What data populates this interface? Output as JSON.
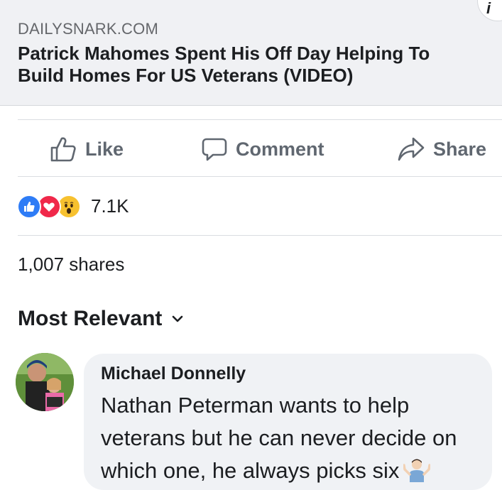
{
  "link_preview": {
    "source": "DAILYSNARK.COM",
    "title": "Patrick Mahomes Spent His Off Day Helping To Build Homes For US Veterans (VIDEO)"
  },
  "actions": {
    "like_label": "Like",
    "comment_label": "Comment",
    "share_label": "Share"
  },
  "reactions": {
    "icons": [
      "like-icon",
      "love-icon",
      "wow-icon"
    ],
    "count": "7.1K"
  },
  "shares_text": "1,007 shares",
  "sort": {
    "label": "Most Relevant",
    "icon": "chevron-down-icon"
  },
  "comment": {
    "author": "Michael Donnelly",
    "text": "Nathan Peterman wants to help veterans but he can never decide on which one, he always picks six",
    "emoji": "man-shrugging-icon"
  },
  "colors": {
    "like_blue": "#2e7cf6",
    "love_red": "#f0284a",
    "wow_yellow": "#f7c12f",
    "action_gray": "#606770",
    "card_bg": "#f0f1f4",
    "bubble_bg": "#f0f2f5"
  }
}
